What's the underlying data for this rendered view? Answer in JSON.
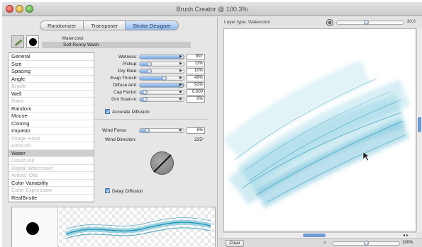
{
  "window": {
    "title": "Brush Creator @ 100.3%"
  },
  "tabs": [
    {
      "label": "Randomizer",
      "active": false
    },
    {
      "label": "Transposer",
      "active": false
    },
    {
      "label": "Stroke Designer",
      "active": true
    }
  ],
  "brush": {
    "category": "Watercolor",
    "variant": "Soft Runny Wash"
  },
  "categories": [
    {
      "label": "General",
      "disabled": false,
      "selected": false
    },
    {
      "label": "Size",
      "disabled": false,
      "selected": false
    },
    {
      "label": "Spacing",
      "disabled": false,
      "selected": false
    },
    {
      "label": "Angle",
      "disabled": false,
      "selected": false
    },
    {
      "label": "Bristle",
      "disabled": true,
      "selected": false
    },
    {
      "label": "Well",
      "disabled": false,
      "selected": false
    },
    {
      "label": "Rake",
      "disabled": true,
      "selected": false
    },
    {
      "label": "Random",
      "disabled": false,
      "selected": false
    },
    {
      "label": "Mouse",
      "disabled": false,
      "selected": false
    },
    {
      "label": "Cloning",
      "disabled": false,
      "selected": false
    },
    {
      "label": "Impasto",
      "disabled": false,
      "selected": false
    },
    {
      "label": "Image Hose",
      "disabled": true,
      "selected": false
    },
    {
      "label": "Airbrush",
      "disabled": true,
      "selected": false
    },
    {
      "label": "Water",
      "disabled": false,
      "selected": true
    },
    {
      "label": "Liquid Ink",
      "disabled": true,
      "selected": false
    },
    {
      "label": "Digital Watercolor",
      "disabled": true,
      "selected": false
    },
    {
      "label": "Artists' Oils",
      "disabled": true,
      "selected": false
    },
    {
      "label": "Color Variability",
      "disabled": false,
      "selected": false
    },
    {
      "label": "Color Expression",
      "disabled": true,
      "selected": false
    },
    {
      "label": "RealBristle",
      "disabled": false,
      "selected": false
    }
  ],
  "water_controls": [
    {
      "label": "Wetness:",
      "value": "997",
      "level": 0.92
    },
    {
      "label": "Pickup:",
      "value": "11%",
      "level": 0.11
    },
    {
      "label": "Dry Rate:",
      "value": "10%",
      "level": 0.1
    },
    {
      "label": "Evap Thresh:",
      "value": "49%",
      "level": 0.49
    },
    {
      "label": "Diffuse Amt:",
      "value": "91%",
      "level": 0.91
    },
    {
      "label": "Cap Factor:",
      "value": "0.000",
      "level": 0.0
    },
    {
      "label": "Grn Soak-In:",
      "value": "0%",
      "level": 0.0
    }
  ],
  "accurate_diffusion": {
    "label": "Accurate Diffusion",
    "checked": true
  },
  "wind_force": {
    "label": "Wind Force:",
    "value": "6%",
    "level": 0.06
  },
  "wind_direction": {
    "label": "Wind Direction:",
    "value": "225°",
    "angle_deg": 225
  },
  "delay_diffusion": {
    "label": "Delay Diffusion",
    "checked": true
  },
  "right": {
    "layer_type": "Layer type: Watercolor",
    "top_zoom_value": "30.0",
    "clear_label": "Clear",
    "bottom_zoom_value": "100%"
  },
  "colors": {
    "accent": "#6e9ad6",
    "stroke_blue": "#3aa8c8",
    "tab_active": "#8fb7ea"
  }
}
